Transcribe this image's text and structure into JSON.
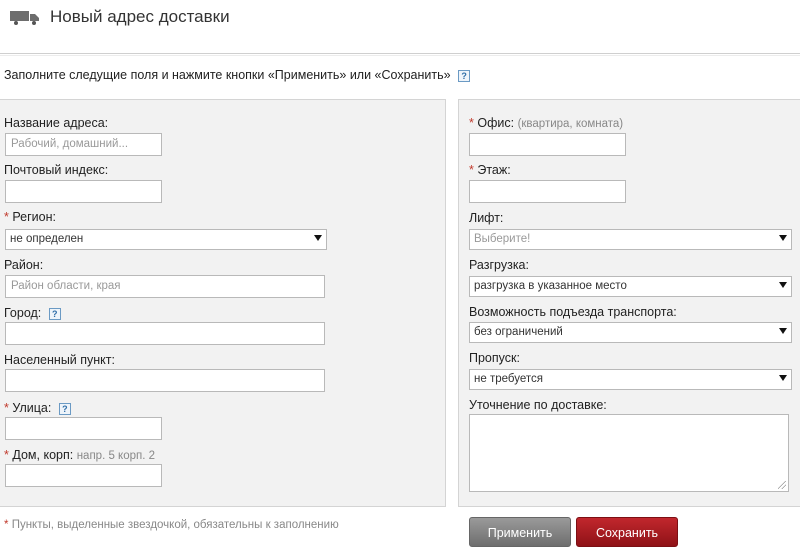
{
  "header": {
    "title": "Новый адрес доставки"
  },
  "intro": {
    "text": "Заполните следущие поля и нажмите кнопки «Применить» или «Сохранить»",
    "help": "?"
  },
  "left": {
    "address_name": {
      "label": "Название адреса:",
      "placeholder": "Рабочий, домашний..."
    },
    "postal_code": {
      "label": "Почтовый индекс:",
      "value": ""
    },
    "region": {
      "required": "*",
      "label": "Регион:",
      "value": "не определен"
    },
    "district": {
      "label": "Район:",
      "placeholder": "Район области, края"
    },
    "city": {
      "label": "Город:",
      "help": "?",
      "value": ""
    },
    "settlement": {
      "label": "Населенный пункт:",
      "value": ""
    },
    "street": {
      "required": "*",
      "label": "Улица:",
      "help": "?",
      "value": ""
    },
    "house": {
      "required": "*",
      "label": "Дом, корп:",
      "hint": "напр. 5 корп. 2",
      "value": ""
    }
  },
  "right": {
    "office": {
      "required": "*",
      "label": "Офис:",
      "hint": "(квартира, комната)",
      "value": ""
    },
    "floor": {
      "required": "*",
      "label": "Этаж:",
      "value": ""
    },
    "elevator": {
      "label": "Лифт:",
      "value": "Выберите!"
    },
    "unloading": {
      "label": "Разгрузка:",
      "value": "разгрузка в указанное место"
    },
    "transport_access": {
      "label": "Возможность подъезда транспорта:",
      "value": "без ограничений"
    },
    "pass": {
      "label": "Пропуск:",
      "value": "не требуется"
    },
    "delivery_note": {
      "label": "Уточнение по доставке:",
      "value": ""
    }
  },
  "footer": {
    "required_star": "*",
    "required_note": "Пункты, выделенные звездочкой, обязательны к заполнению",
    "apply_label": "Применить",
    "save_label": "Сохранить"
  },
  "colors": {
    "required": "#c0392b",
    "save_button": "#a51b21",
    "apply_button": "#858585",
    "panel_bg": "#f2f2f2"
  },
  "icons": {
    "header": "truck-icon",
    "help": "help-icon"
  }
}
